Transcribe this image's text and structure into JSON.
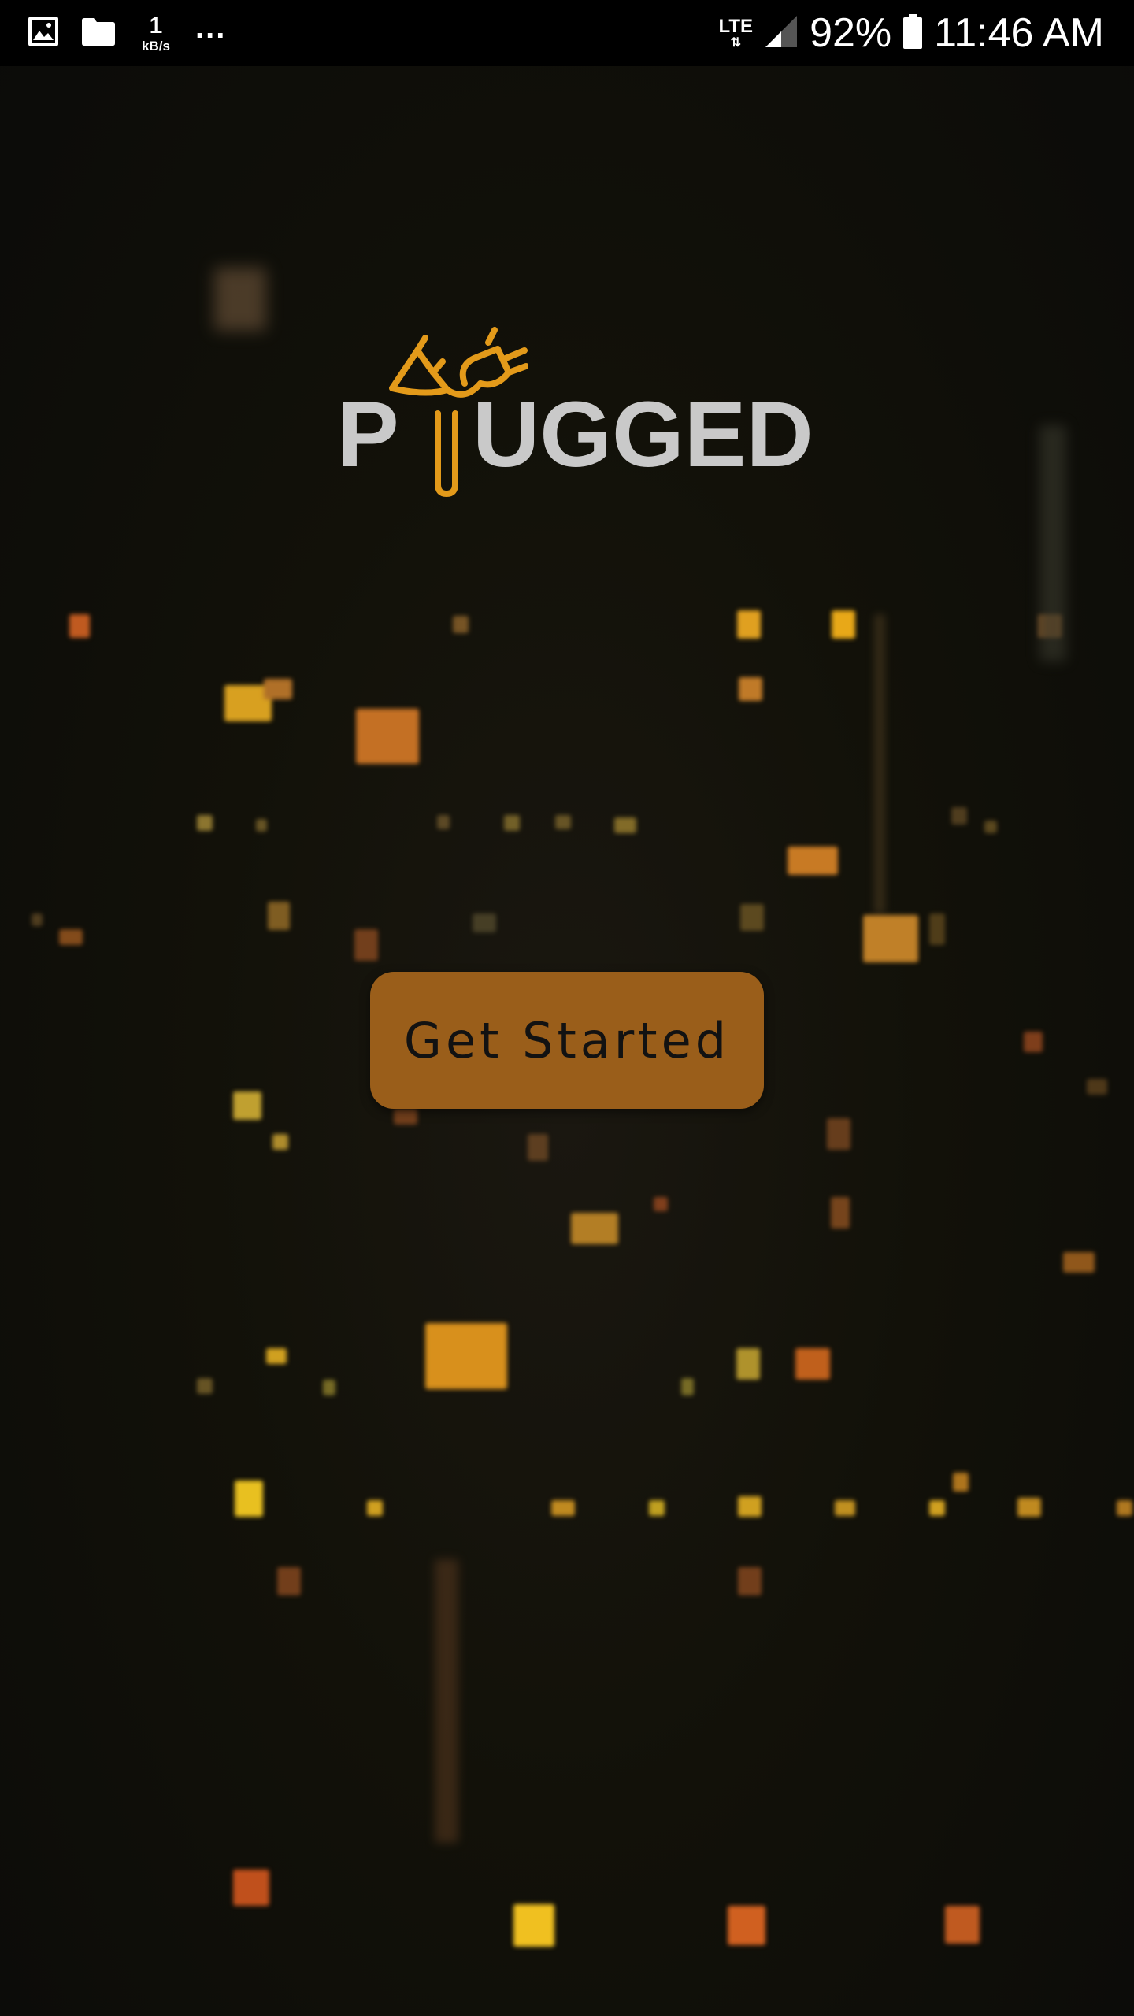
{
  "status_bar": {
    "left_icons": [
      "image-icon",
      "folder-icon"
    ],
    "network_speed_value": "1",
    "network_speed_unit": "kB/s",
    "overflow_indicator": "...",
    "network_type": "LTE",
    "network_arrows": "⇅",
    "battery_percent": "92%",
    "time": "11:46 AM"
  },
  "logo": {
    "text_first": "P",
    "text_rest": "UGGED",
    "icon": "plug-icon",
    "colors": {
      "text": "#c9c9c9",
      "icon": "#e39a1a"
    }
  },
  "main": {
    "get_started_label": "Get Started"
  },
  "colors": {
    "button_background": "#9a5e1a",
    "button_text": "#121212",
    "background": "#0c0c0a",
    "bokeh_amber": "#d9901c",
    "bokeh_gold": "#f0c020",
    "bokeh_orange": "#d86a20"
  }
}
